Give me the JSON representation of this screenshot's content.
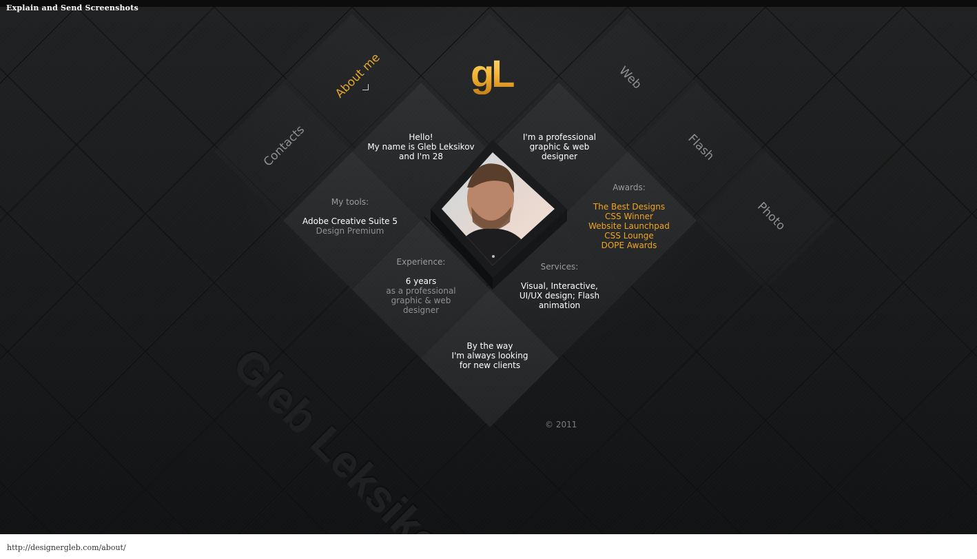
{
  "window": {
    "title": "Explain and Send Screenshots"
  },
  "status": {
    "url": "http://designergleb.com/about/"
  },
  "logo": {
    "text": "gL"
  },
  "nav": {
    "about": "About me",
    "contacts": "Contacts",
    "web": "Web",
    "flash": "Flash",
    "photo": "Photo"
  },
  "intro": {
    "line1": "Hello!",
    "line2": "My name is Gleb Leksikov",
    "line3": "and I'm 28"
  },
  "profession": {
    "line1": "I'm a professional",
    "line2": "graphic & web",
    "line3": "designer"
  },
  "tools": {
    "label": "My tools:",
    "name": "Adobe Creative Suite 5",
    "edition": "Design Premium"
  },
  "awards": {
    "label": "Awards:",
    "items": [
      "The Best Designs",
      "CSS Winner",
      "Website Launchpad",
      "CSS Lounge",
      "DOPE Awards"
    ]
  },
  "experience": {
    "label": "Experience:",
    "years": "6 years",
    "line1": "as a professional",
    "line2": "graphic & web",
    "line3": "designer"
  },
  "services": {
    "label": "Services:",
    "line1": "Visual, Interactive,",
    "line2": "UI/UX design; Flash",
    "line3": "animation"
  },
  "clients": {
    "line1": "By the way",
    "line2": "I'm always looking",
    "line3": "for new clients"
  },
  "watermark": "Gleb Leksikov",
  "footer": {
    "copyright": "© 2011"
  },
  "colors": {
    "accent": "#f0a522",
    "background": "#141516",
    "muted": "#9a9c9e"
  },
  "icons": {
    "portrait": "portrait-photo"
  }
}
